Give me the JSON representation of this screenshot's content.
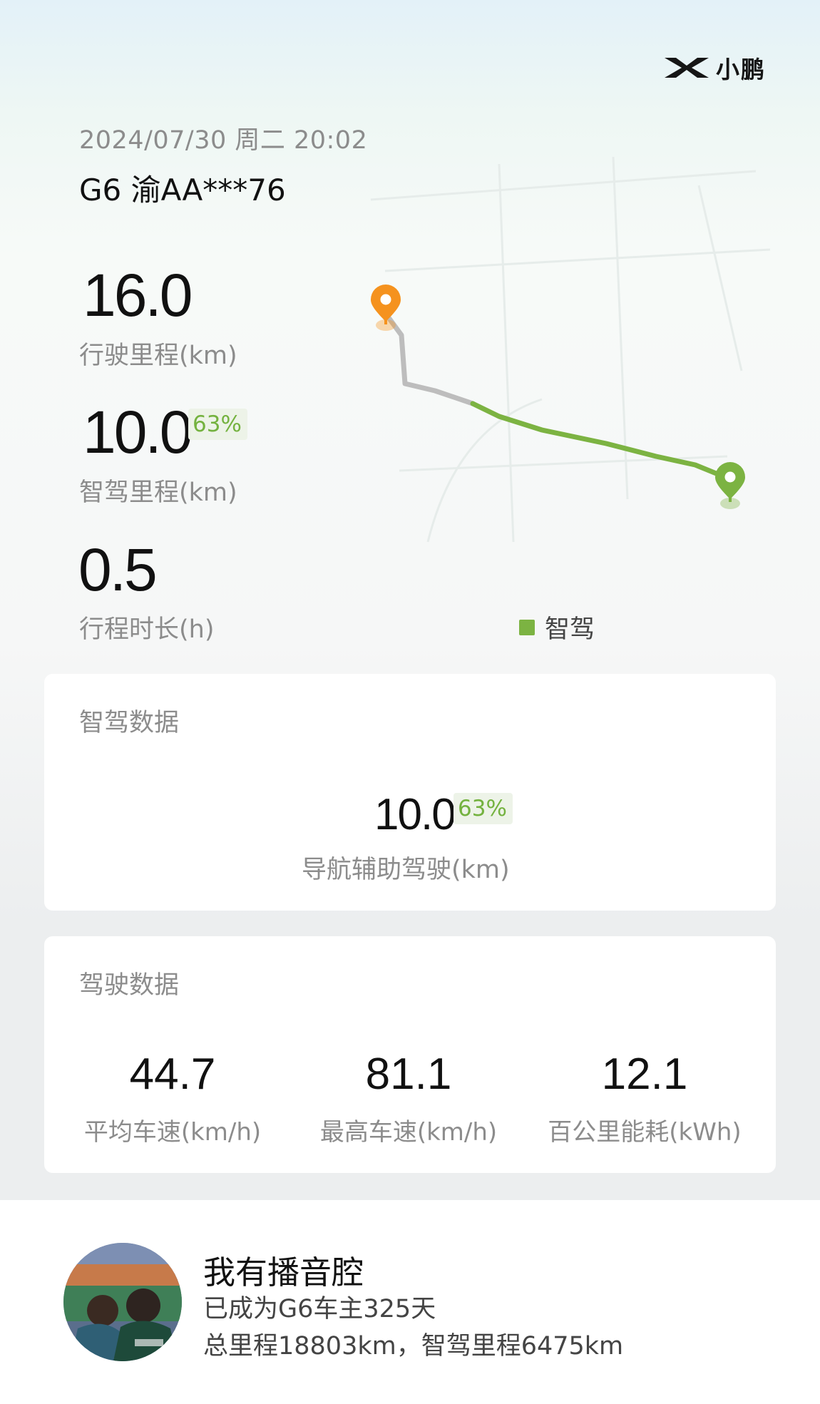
{
  "brand": {
    "name": "小鹏",
    "icon": "xpeng-logo-icon"
  },
  "trip": {
    "date": "2024/07/30 周二 20:02",
    "vehicle": "G6 渝AA***76"
  },
  "stats": {
    "distance": {
      "value": "16.0",
      "label": "行驶里程(km)"
    },
    "smart_distance": {
      "value": "10.0",
      "badge": "63%",
      "label": "智驾里程(km)"
    },
    "duration": {
      "value": "0.5",
      "label": "行程时长(h)"
    }
  },
  "map": {
    "legend_label": "智驾",
    "colors": {
      "smart_route": "#7cb342",
      "manual_route": "#bdbdbd",
      "start_pin": "#f5921e",
      "end_pin": "#7cb342"
    },
    "start_icon": "start-location-pin-icon",
    "end_icon": "end-location-pin-icon"
  },
  "smart_drive_card": {
    "title": "智驾数据",
    "value": "10.0",
    "badge": "63%",
    "label": "导航辅助驾驶(km)"
  },
  "drive_card": {
    "title": "驾驶数据",
    "metrics": [
      {
        "value": "44.7",
        "label": "平均车速(km/h)"
      },
      {
        "value": "81.1",
        "label": "最高车速(km/h)"
      },
      {
        "value": "12.1",
        "label": "百公里能耗(kWh)"
      }
    ]
  },
  "owner": {
    "name": "我有播音腔",
    "ownership": "已成为G6车主325天",
    "mileage": "总里程18803km，智驾里程6475km"
  }
}
